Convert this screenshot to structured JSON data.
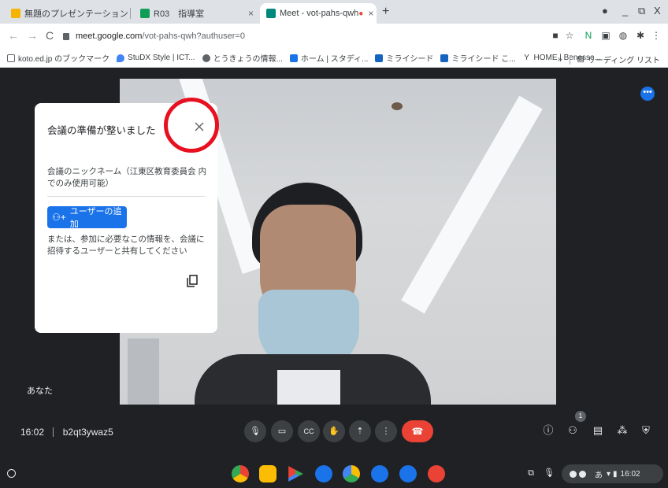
{
  "browser": {
    "tabs": [
      {
        "title": "無題のプレゼンテーション - G",
        "favicon_color": "#f4b400",
        "active": false
      },
      {
        "title": "R03　指導室",
        "favicon_color": "#0f9d58",
        "active": false
      },
      {
        "title": "Meet - vot-pahs-qwh",
        "favicon_color": "#00897b",
        "active": true
      }
    ],
    "new_tab_label": "+",
    "address": {
      "host": "meet.google.com",
      "path": "/vot-pahs-qwh?authuser=0"
    },
    "bookmarks": [
      {
        "label": "koto.ed.jp のブックマーク",
        "icon": "folder-icon",
        "color": "#5f6368"
      },
      {
        "label": "StuDX Style | ICT...",
        "icon": "drop-icon",
        "color": "#4285f4"
      },
      {
        "label": "とうきょうの情報...",
        "icon": "globe-icon",
        "color": "#5f6368"
      },
      {
        "label": "ホーム | スタディ...",
        "icon": "z-icon",
        "color": "#1a73e8"
      },
      {
        "label": "ミライシード",
        "icon": "mail-icon",
        "color": "#1565c0"
      },
      {
        "label": "ミライシード こ...",
        "icon": "mail-icon",
        "color": "#1565c0"
      },
      {
        "label": "HOME | Benesse...",
        "icon": "y-icon",
        "color": "#3c4043"
      }
    ],
    "bookmarks_overflow": "»",
    "reading_list": "リーディング リスト"
  },
  "meeting": {
    "self_label": "あなた",
    "panel": {
      "title": "会議の準備が整いました",
      "close_label": "X",
      "nickname_text": "会議のニックネーム（江東区教育委員会 内でのみ使用可能）",
      "add_user_label": "ユーザーの追加",
      "info_text": "または、参加に必要なこの情報を、会議に招待するユーザーと共有してください"
    },
    "time": "16:02",
    "code": "b2qt3ywaz5",
    "participants_count": "1",
    "controls": [
      {
        "name": "mic-button",
        "glyph": "🎙"
      },
      {
        "name": "camera-button",
        "glyph": "▭"
      },
      {
        "name": "captions-button",
        "glyph": "CC"
      },
      {
        "name": "raise-hand-button",
        "glyph": "✋"
      },
      {
        "name": "present-button",
        "glyph": "⇡"
      },
      {
        "name": "more-options-button",
        "glyph": "⋮"
      }
    ]
  },
  "shelf": {
    "apps": [
      {
        "name": "chrome-app",
        "color": "#4285f4"
      },
      {
        "name": "classroom-app",
        "color": "#0f9d58"
      },
      {
        "name": "play-store-app",
        "color": "#34a853"
      },
      {
        "name": "files-app",
        "color": "#1a73e8"
      },
      {
        "name": "drive-app",
        "color": "#fbbc04"
      },
      {
        "name": "meet-app",
        "color": "#1a73e8"
      },
      {
        "name": "camera-app",
        "color": "#1a73e8"
      },
      {
        "name": "gallery-app",
        "color": "#ea4335"
      }
    ],
    "ime": "あ",
    "clock": "16:02"
  }
}
